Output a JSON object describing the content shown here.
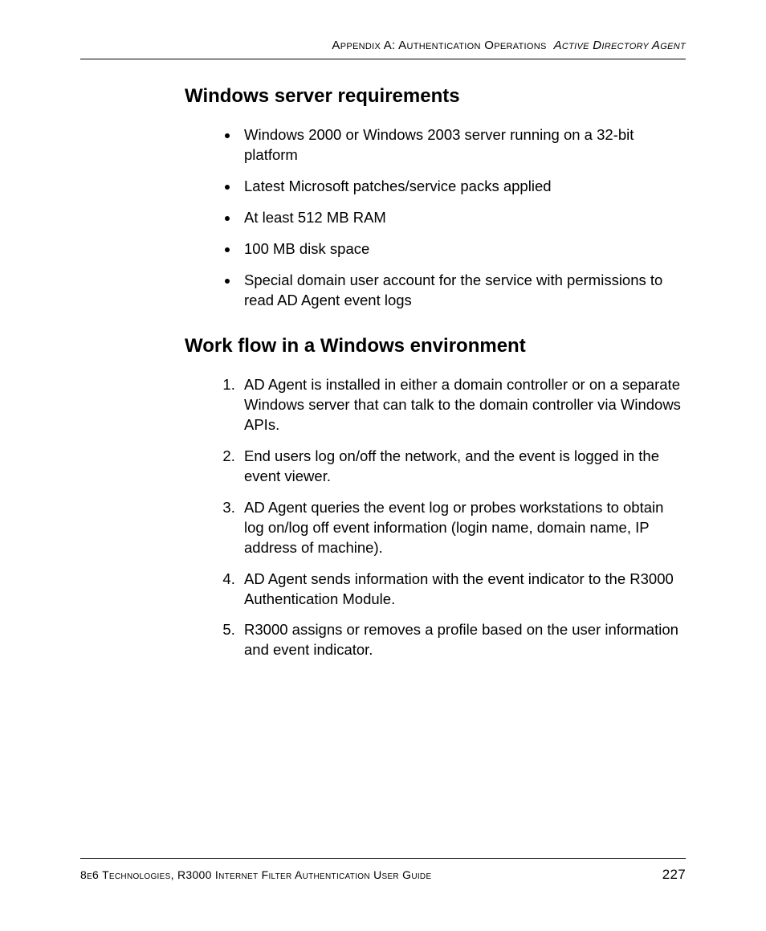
{
  "header": {
    "left": "Appendix A: Authentication Operations",
    "right_italic": "Active Directory Agent"
  },
  "sections": {
    "s1": {
      "title": "Windows server requirements",
      "items": [
        "Windows 2000 or Windows 2003 server running on a 32-bit platform",
        "Latest Microsoft patches/service packs applied",
        "At least 512 MB RAM",
        "100 MB disk space",
        "Special domain user account for the service with permissions to read AD Agent event logs"
      ]
    },
    "s2": {
      "title": "Work flow in a Windows environment",
      "items": [
        "AD Agent is installed in either a domain controller or on a separate Windows server that can talk to the domain controller via Windows APIs.",
        "End users log on/off the network, and the event is logged in the event viewer.",
        "AD Agent queries the event log or probes workstations to obtain log on/log off event information (login name, domain name, IP address of machine).",
        "AD Agent sends information with the event indicator to the R3000 Authentication Module.",
        "R3000 assigns or removes a profile based on the user information and event indicator."
      ]
    }
  },
  "footer": {
    "text": "8e6 Technologies, R3000 Internet Filter Authentication User Guide",
    "page": "227"
  }
}
